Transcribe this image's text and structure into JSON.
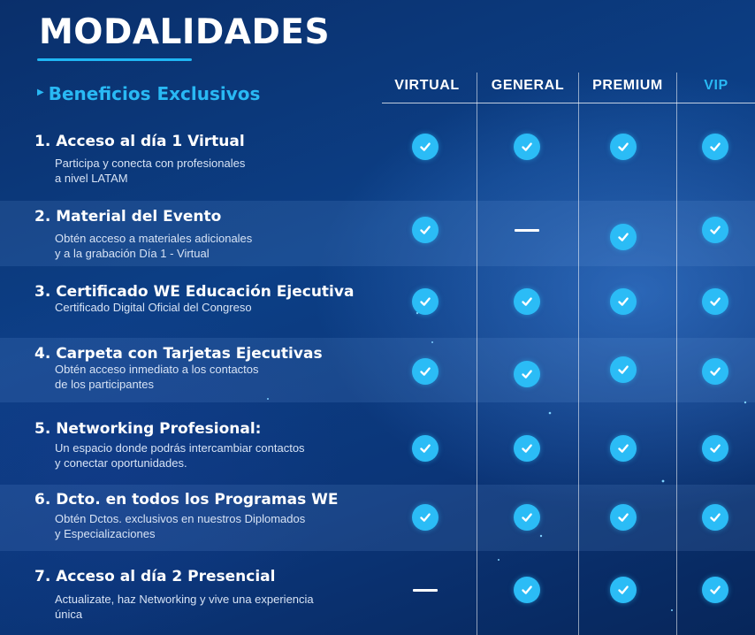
{
  "title": "MODALIDADES",
  "subtitle": "Beneficios Exclusivos",
  "columns": [
    "VIRTUAL",
    "GENERAL",
    "PREMIUM",
    "VIP"
  ],
  "colors": {
    "accent": "#29b9f4",
    "check": "#2bbcf6",
    "background": "#0c3f86"
  },
  "icons": {
    "included": "check-circle-icon",
    "not_included": "dash-icon",
    "bullet": "triangle-right-icon"
  },
  "rows": [
    {
      "title": "1. Acceso al día 1 Virtual",
      "desc": "Participa y conecta con profesionales\na nivel LATAM",
      "cells": [
        true,
        true,
        true,
        true
      ]
    },
    {
      "title": "2. Material del Evento",
      "desc": "Obtén acceso a materiales adicionales\ny a la grabación Día 1 - Virtual",
      "cells": [
        true,
        false,
        true,
        true
      ]
    },
    {
      "title": "3. Certificado WE Educación Ejecutiva",
      "desc": "Certificado Digital Oficial del Congreso",
      "cells": [
        true,
        true,
        true,
        true
      ]
    },
    {
      "title": "4. Carpeta con Tarjetas Ejecutivas",
      "desc": "Obtén acceso inmediato a los contactos\nde los participantes",
      "cells": [
        true,
        true,
        true,
        true
      ]
    },
    {
      "title": "5. Networking Profesional:",
      "desc": "Un espacio donde podrás intercambiar contactos\ny conectar oportunidades.",
      "cells": [
        true,
        true,
        true,
        true
      ]
    },
    {
      "title": "6. Dcto. en todos los Programas WE",
      "desc": "Obtén Dctos. exclusivos en nuestros Diplomados\ny Especializaciones",
      "cells": [
        true,
        true,
        true,
        true
      ]
    },
    {
      "title": "7. Acceso al día 2 Presencial",
      "desc": "Actualizate, haz Networking y vive una experiencia\núnica",
      "cells": [
        false,
        true,
        true,
        true
      ]
    }
  ]
}
